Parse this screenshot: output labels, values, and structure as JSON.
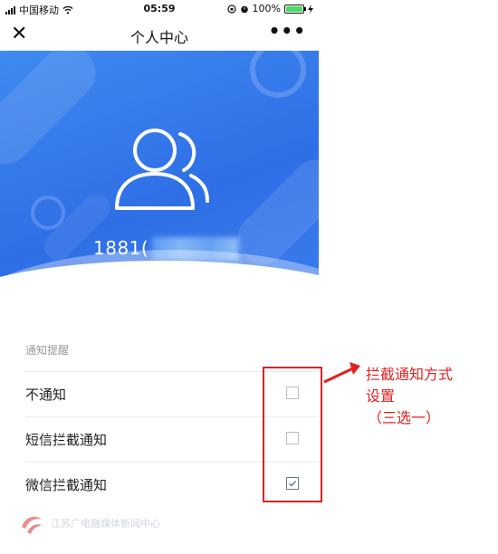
{
  "status_bar": {
    "carrier": "中国移动",
    "time": "05:59",
    "battery": "100%"
  },
  "nav": {
    "title": "个人中心",
    "close_icon": "close-icon",
    "more_icon": "more-icon"
  },
  "profile": {
    "phone_visible": "1881(",
    "avatar_icon": "users-icon"
  },
  "notifications": {
    "section_label": "通知提醒",
    "options": [
      {
        "label": "不通知",
        "checked": false
      },
      {
        "label": "短信拦截通知",
        "checked": false
      },
      {
        "label": "微信拦截通知",
        "checked": true
      }
    ]
  },
  "annotation": {
    "line1": "拦截通知方式",
    "line2": "设置",
    "line3": "（三选一）"
  },
  "watermark": {
    "text": "江苏广电融媒体新闻中心"
  },
  "colors": {
    "hero_blue": "#2f6fe6",
    "annotation_red": "#e02020",
    "battery_green": "#4cd964"
  }
}
